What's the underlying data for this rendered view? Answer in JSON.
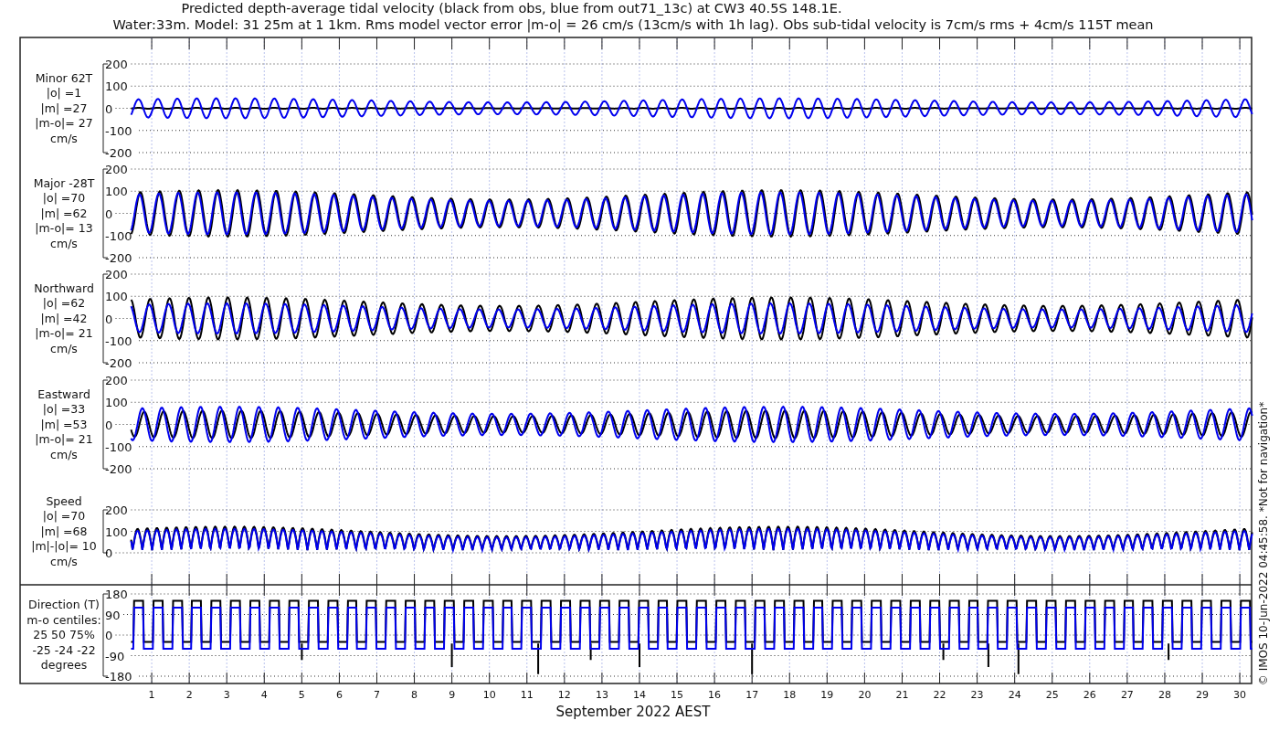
{
  "title_lines": [
    "Predicted depth-average tidal velocity (black from obs, blue from out71_13c) at CW3 40.5S 148.1E.",
    "Water:33m. Model: 31 25m at 1 1km. Rms model vector error |m-o| = 26 cm/s (13cm/s with 1h lag). Obs sub-tidal velocity is 7cm/s rms + 4cm/s 115T mean"
  ],
  "panels": [
    {
      "kind": "velocity",
      "label_lines": [
        "Minor 62T",
        "|o| =1",
        "|m| =27",
        "|m-o|= 27",
        "cm/s"
      ],
      "axis_labels": [
        "200",
        "100",
        "0",
        "-100",
        "-200"
      ]
    },
    {
      "kind": "velocity",
      "label_lines": [
        "Major -28T",
        "|o| =70",
        "|m| =62",
        "|m-o|= 13",
        "cm/s"
      ],
      "axis_labels": [
        "200",
        "100",
        "0",
        "-100",
        "-200"
      ]
    },
    {
      "kind": "velocity",
      "label_lines": [
        "Northward",
        "|o| =62",
        "|m| =42",
        "|m-o|= 21",
        "cm/s"
      ],
      "axis_labels": [
        "200",
        "100",
        "0",
        "-100",
        "-200"
      ]
    },
    {
      "kind": "velocity",
      "label_lines": [
        "Eastward",
        "|o| =33",
        "|m| =53",
        "|m-o|= 21",
        "cm/s"
      ],
      "axis_labels": [
        "200",
        "100",
        "0",
        "-100",
        "-200"
      ]
    },
    {
      "kind": "speed",
      "label_lines": [
        "Speed",
        "|o| =70",
        "|m| =68",
        "|m|-|o|= 10",
        "cm/s"
      ],
      "axis_labels": [
        "200",
        "100",
        "0"
      ]
    },
    {
      "kind": "direction",
      "label_lines": [
        "Direction (T)",
        "m-o centiles:",
        "25  50  75%",
        "-25 -24 -22",
        "degrees"
      ],
      "axis_labels": [
        "180",
        "90",
        "0",
        "-90",
        "-180"
      ]
    }
  ],
  "x_labels": [
    "1",
    "2",
    "3",
    "4",
    "5",
    "6",
    "7",
    "8",
    "9",
    "10",
    "11",
    "12",
    "13",
    "14",
    "15",
    "16",
    "17",
    "18",
    "19",
    "20",
    "21",
    "22",
    "23",
    "24",
    "25",
    "26",
    "27",
    "28",
    "29",
    "30"
  ],
  "xlabel": "September 2022 AEST",
  "credit": "© IMOS 10-Jun-2022 04:45:58.  *Not for navigation*"
}
